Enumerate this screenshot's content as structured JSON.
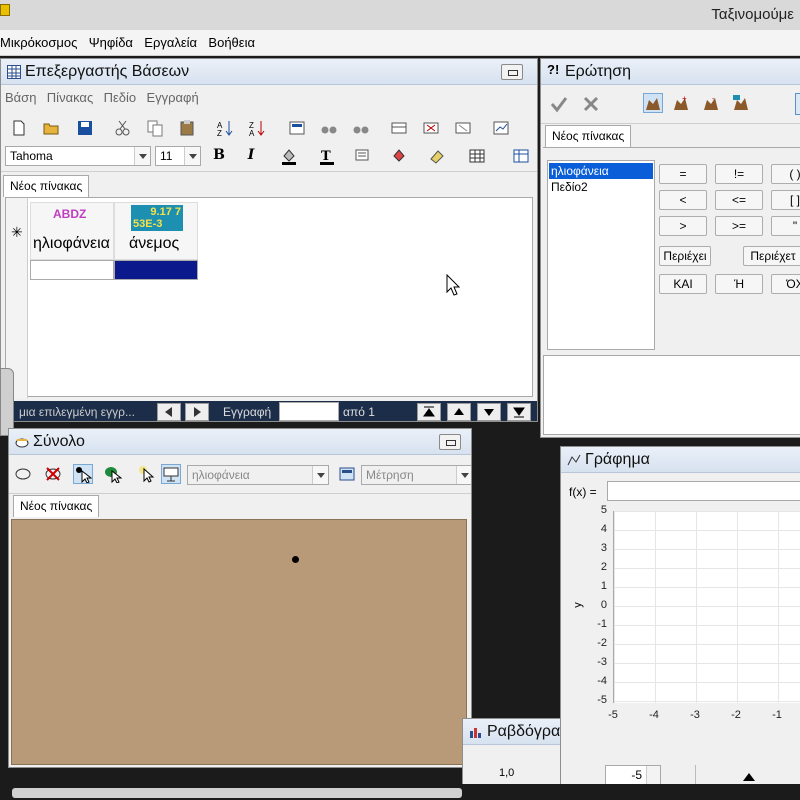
{
  "app": {
    "title": "Ταξινομούμε",
    "menu": [
      "Μικρόκοσμος",
      "Ψηφίδα",
      "Εργαλεία",
      "Βοήθεια"
    ]
  },
  "db_editor": {
    "title": "Επεξεργαστής Βάσεων",
    "menu": [
      "Βάση",
      "Πίνακας",
      "Πεδίο",
      "Εγγραφή"
    ],
    "font_name": "Tahoma",
    "font_size": "11",
    "tab": "Νέος πίνακας",
    "columns": [
      {
        "icon_text": "ABDZ",
        "name": "ηλιοφάνεια"
      },
      {
        "icon_text_1": "9.17 7",
        "icon_text_2": "53E-3",
        "name": "άνεμος"
      }
    ],
    "status": "μια επιλεγμένη εγγρ...",
    "record_label": "Εγγραφή",
    "record_of": "από 1"
  },
  "query": {
    "title": "Ερώτηση",
    "tab": "Νέος πίνακας",
    "fields": [
      "ηλιοφάνεια",
      "Πεδίο2"
    ],
    "selected_field": "ηλιοφάνεια",
    "operators": [
      "=",
      "!=",
      "( )",
      "<",
      "<=",
      "[ ]",
      ">",
      ">=",
      "\""
    ],
    "text_ops": [
      "Περιέχει",
      "Περιέχετ"
    ],
    "logic_ops": [
      "ΚΑΙ",
      "Ή",
      "ΌΧ"
    ]
  },
  "total": {
    "title": "Σύνολο",
    "field_select": "ηλιοφάνεια",
    "measure_select": "Μέτρηση",
    "tab": "Νέος πίνακας",
    "canvas_color": "#b89a78"
  },
  "graph": {
    "title": "Γράφημα",
    "fx_label": "f(x) =",
    "fx_value": "",
    "ylabel": "y",
    "yticks": [
      "5",
      "4",
      "3",
      "2",
      "1",
      "0",
      "-1",
      "-2",
      "-3",
      "-4",
      "-5"
    ],
    "xticks": [
      "-5",
      "-4",
      "-3",
      "-2",
      "-1"
    ],
    "spinner_value": "-5"
  },
  "bar_chart": {
    "title": "Ραβδόγρα",
    "tick": "1,0"
  }
}
